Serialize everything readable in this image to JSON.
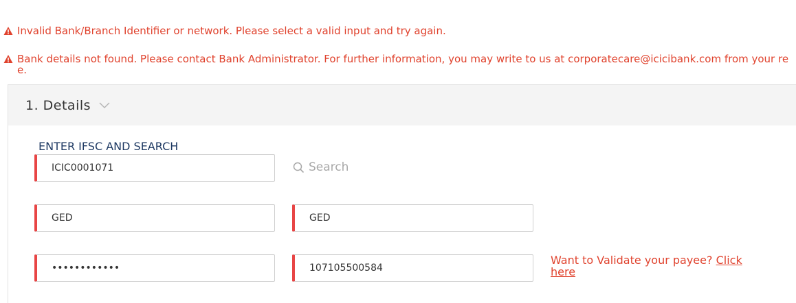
{
  "errors": [
    "Invalid Bank/Branch Identifier or network. Please select a valid input and try again.",
    "Bank details not found. Please contact Bank Administrator. For further information, you may write to us at corporatecare@icicibank.com from your re e."
  ],
  "panel": {
    "title": "1. Details",
    "section_label": "ENTER IFSC AND SEARCH"
  },
  "form": {
    "ifsc_value": "ICIC0001071",
    "search_label": "Search",
    "name_value_1": "GED",
    "name_value_2": "GED",
    "account_masked": "••••••••••••",
    "account_confirm": "107105500584"
  },
  "validate": {
    "prompt": "Want to Validate your payee?",
    "link_label": "Click here"
  },
  "colors": {
    "error": "#e0422d",
    "field_accent": "#e84545",
    "section_label": "#1f3a63"
  }
}
